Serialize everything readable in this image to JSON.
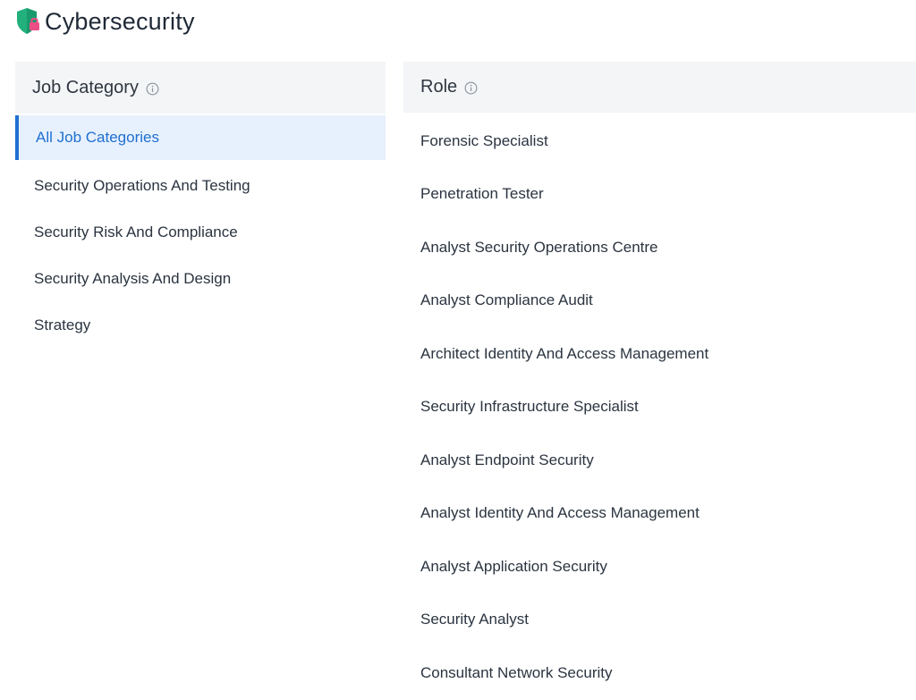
{
  "header": {
    "title": "Cybersecurity",
    "logo_icon": "shield-lock-icon",
    "colors": {
      "shield": "#22b07d",
      "lock": "#ec4f86"
    }
  },
  "job_category": {
    "heading": "Job Category",
    "info_icon": "info-icon",
    "items": [
      {
        "label": "All Job Categories",
        "active": true
      },
      {
        "label": "Security Operations And Testing",
        "active": false
      },
      {
        "label": "Security Risk And Compliance",
        "active": false
      },
      {
        "label": "Security Analysis And Design",
        "active": false
      },
      {
        "label": "Strategy",
        "active": false
      }
    ]
  },
  "role": {
    "heading": "Role",
    "info_icon": "info-icon",
    "items": [
      "Forensic Specialist",
      "Penetration Tester",
      "Analyst Security Operations Centre",
      "Analyst Compliance Audit",
      "Architect Identity And Access Management",
      "Security Infrastructure Specialist",
      "Analyst Endpoint Security",
      "Analyst Identity And Access Management",
      "Analyst Application Security",
      "Security Analyst",
      "Consultant Network Security"
    ]
  },
  "colors": {
    "accent": "#1f6fd1",
    "active_bg": "#e7f1fd",
    "panel_header_bg": "#f4f5f7"
  }
}
